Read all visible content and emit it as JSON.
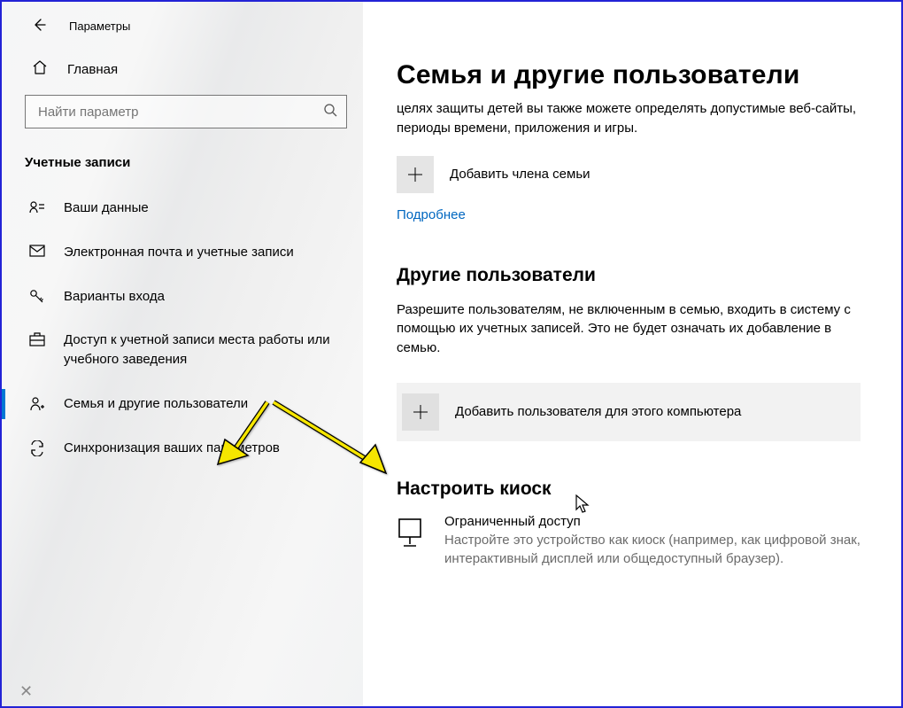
{
  "titlebar": {
    "title": "Параметры"
  },
  "home": {
    "label": "Главная"
  },
  "search": {
    "placeholder": "Найти параметр"
  },
  "section": "Учетные записи",
  "nav": {
    "items": [
      {
        "label": "Ваши данные"
      },
      {
        "label": "Электронная почта и учетные записи"
      },
      {
        "label": "Варианты входа"
      },
      {
        "label": "Доступ к учетной записи места работы или учебного заведения"
      },
      {
        "label": "Семья и другие пользователи"
      },
      {
        "label": "Синхронизация ваших параметров"
      }
    ]
  },
  "main": {
    "heading": "Семья и другие пользователи",
    "intro": "целях защиты детей вы также можете определять допустимые веб-сайты, периоды времени, приложения и игры.",
    "add_family": "Добавить члена семьи",
    "more": "Подробнее",
    "other_heading": "Другие пользователи",
    "other_desc": "Разрешите пользователям, не включенным в семью, входить в систему с помощью их учетных записей. Это не будет означать их добавление в семью.",
    "add_user": "Добавить пользователя для этого компьютера",
    "kiosk_heading": "Настроить киоск",
    "kiosk_title": "Ограниченный доступ",
    "kiosk_desc": "Настройте это устройство как киоск (например, как цифровой знак, интерактивный дисплей или общедоступный браузер)."
  }
}
